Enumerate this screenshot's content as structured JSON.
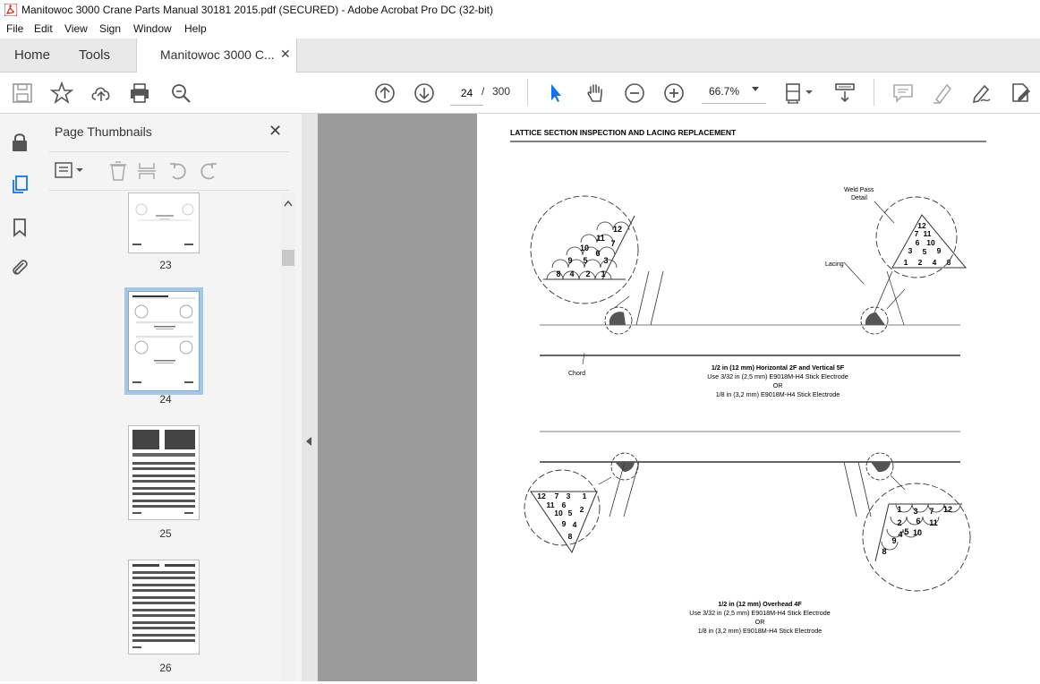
{
  "window": {
    "title": "Manitowoc 3000 Crane Parts Manual 30181 2015.pdf (SECURED) - Adobe Acrobat Pro DC (32-bit)"
  },
  "menu": [
    "File",
    "Edit",
    "View",
    "Sign",
    "Window",
    "Help"
  ],
  "tabs": {
    "home": "Home",
    "tools": "Tools",
    "doc": "Manitowoc 3000 C...",
    "close": "✕"
  },
  "toolbar": {
    "page_current": "24",
    "page_sep": "/",
    "page_total": "300",
    "zoom": "66.7%"
  },
  "panel": {
    "title": "Page Thumbnails",
    "close": "✕",
    "thumbs": [
      {
        "num": "23"
      },
      {
        "num": "24"
      },
      {
        "num": "25"
      },
      {
        "num": "26"
      }
    ]
  },
  "document": {
    "heading": "LATTICE SECTION INSPECTION AND LACING REPLACEMENT",
    "weld_pass_label_1": "Weld Pass",
    "weld_pass_label_2": "Detail",
    "lacing_label": "Lacing",
    "chord_label": "Chord",
    "upper_caption": {
      "line1": "1/2 in (12 mm) Horizontal 2F and Vertical 5F",
      "line2": "Use 3/32 in (2,5 mm) E9018M-H4 Stick Electrode",
      "line3": "OR",
      "line4": "1/8 in (3,2 mm) E9018M-H4 Stick Electrode"
    },
    "lower_caption": {
      "line1": "1/2 in (12 mm) Overhead 4F",
      "line2": "Use 3/32 in (2,5 mm) E9018M-H4 Stick Electrode",
      "line3": "OR",
      "line4": "1/8 in (3,2 mm) E9018M-H4 Stick Electrode"
    },
    "passes": [
      "1",
      "2",
      "3",
      "4",
      "5",
      "6",
      "7",
      "8",
      "9",
      "10",
      "11",
      "12"
    ]
  }
}
